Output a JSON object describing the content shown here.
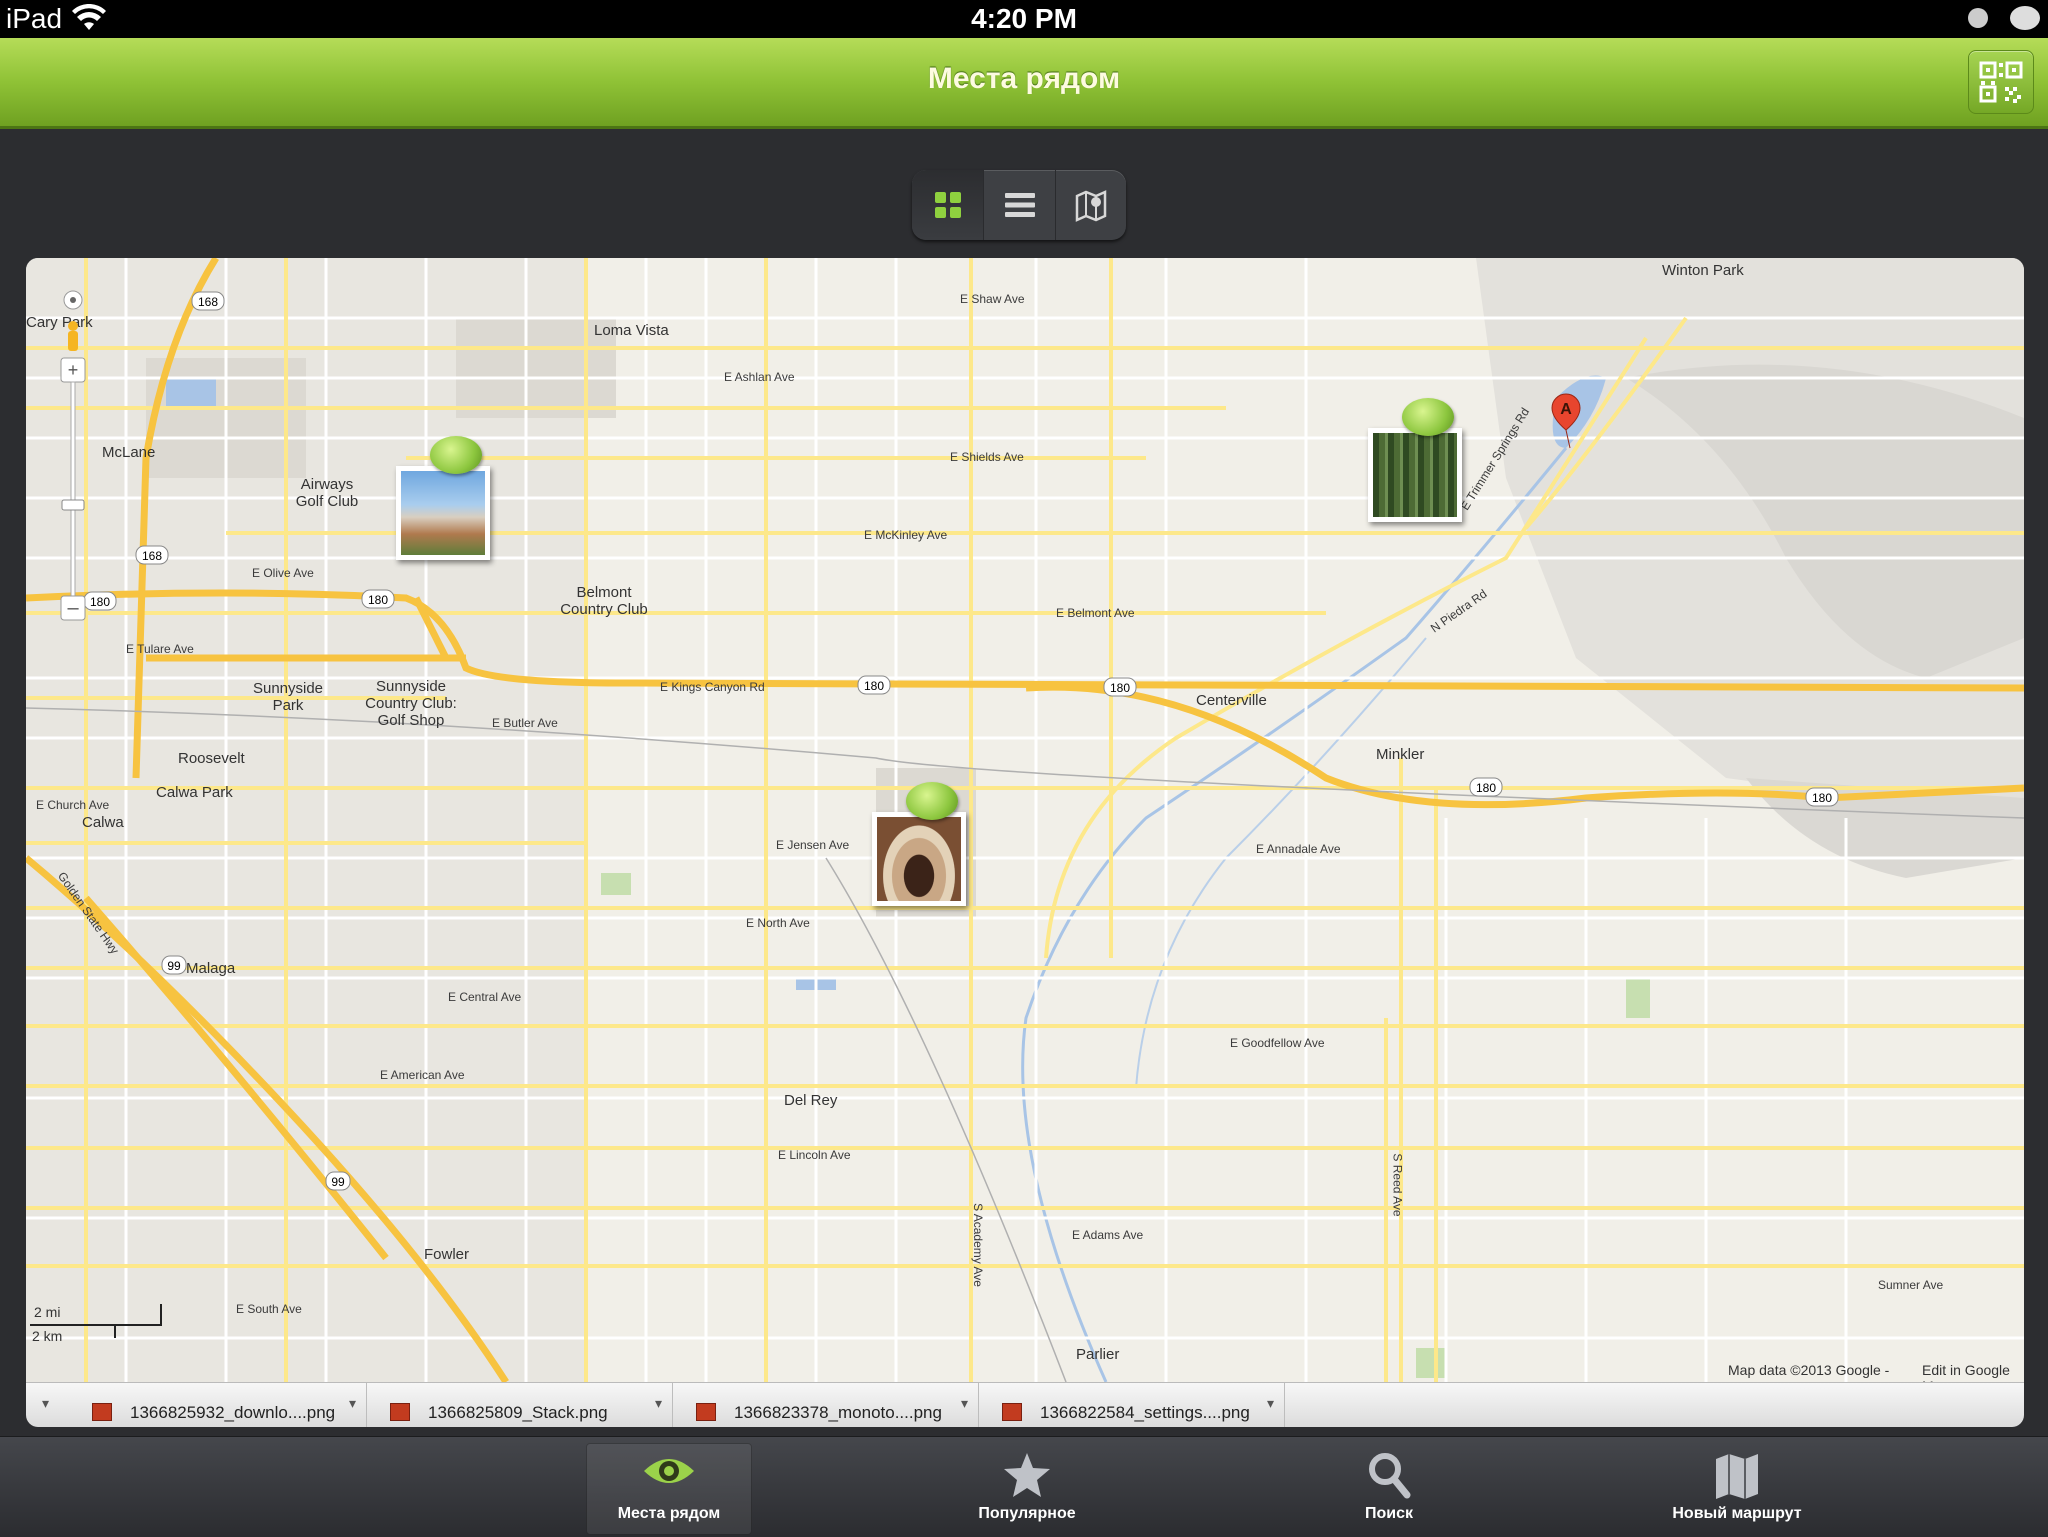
{
  "status_bar": {
    "carrier": "iPad",
    "time": "4:20 PM"
  },
  "nav_bar": {
    "title": "Места рядом",
    "qr_icon": "qr-code-icon"
  },
  "view_switcher": {
    "segments": [
      "grid-view-icon",
      "list-view-icon",
      "map-view-icon"
    ],
    "selected": "grid-view-icon"
  },
  "map": {
    "places": [
      {
        "text": "Winton Park"
      },
      {
        "text": "Loma Vista"
      },
      {
        "text": "Cary Park"
      },
      {
        "text": "McLane"
      },
      {
        "text": "Airways Golf Club"
      },
      {
        "text": "Belmont Country Club"
      },
      {
        "text": "Sunnyside Park"
      },
      {
        "text": "Sunnyside Country Club: Golf Shop"
      },
      {
        "text": "Roosevelt"
      },
      {
        "text": "Calwa Park"
      },
      {
        "text": "Calwa"
      },
      {
        "text": "Malaga"
      },
      {
        "text": "Centerville"
      },
      {
        "text": "Minkler"
      },
      {
        "text": "Del Rey"
      },
      {
        "text": "Fowler"
      },
      {
        "text": "Parlier"
      }
    ],
    "roads": [
      {
        "text": "E Shaw Ave"
      },
      {
        "text": "E Ashlan Ave"
      },
      {
        "text": "E Shields Ave"
      },
      {
        "text": "E McKinley Ave"
      },
      {
        "text": "E Olive Ave"
      },
      {
        "text": "E Belmont Ave"
      },
      {
        "text": "E Tulare Ave"
      },
      {
        "text": "E Kings Canyon Rd"
      },
      {
        "text": "E Butler Ave"
      },
      {
        "text": "E Church Ave"
      },
      {
        "text": "E Jensen Ave"
      },
      {
        "text": "E Annadale Ave"
      },
      {
        "text": "E North Ave"
      },
      {
        "text": "E Central Ave"
      },
      {
        "text": "E Goodfellow Ave"
      },
      {
        "text": "E American Ave"
      },
      {
        "text": "E Lincoln Ave"
      },
      {
        "text": "E Adams Ave"
      },
      {
        "text": "E South Ave"
      },
      {
        "text": "N Piedra Rd"
      },
      {
        "text": "E Trimmer Springs Rd"
      },
      {
        "text": "S Academy Ave"
      },
      {
        "text": "S Reed Ave"
      },
      {
        "text": "Golden State Hwy"
      },
      {
        "text": "Sumner Ave"
      }
    ],
    "highway_shields": [
      "168",
      "168",
      "168",
      "180",
      "180",
      "180",
      "180",
      "180",
      "99",
      "99"
    ],
    "attribution": "Map data ©2013 Google -",
    "edit_link": "Edit in Google M",
    "scale_mi": "2 mi",
    "scale_km": "2 km",
    "marker_letter": "A"
  },
  "files": [
    {
      "name": "1366825932_downlo....png"
    },
    {
      "name": "1366825809_Stack.png"
    },
    {
      "name": "1366823378_monoto....png"
    },
    {
      "name": "1366822584_settings....png"
    }
  ],
  "tabs": [
    {
      "label": "Места рядом",
      "icon": "eye-icon"
    },
    {
      "label": "Популярное",
      "icon": "star-icon"
    },
    {
      "label": "Поиск",
      "icon": "search-icon"
    },
    {
      "label": "Новый маршрут",
      "icon": "route-map-icon"
    }
  ],
  "colors": {
    "nav_green": "#8fc236",
    "pin_green": "#8cc63e",
    "highway_yellow": "#f7c340",
    "road_yellow": "#fde88a"
  }
}
